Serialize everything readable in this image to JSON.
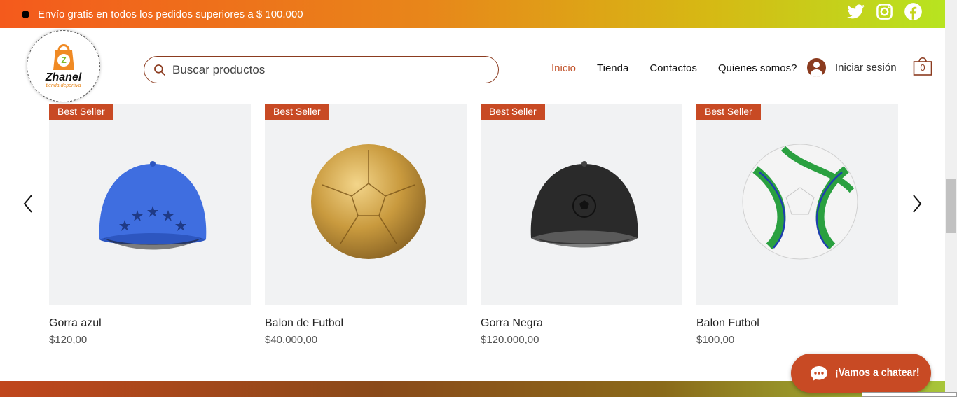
{
  "promo": {
    "text": "Envío gratis en todos los pedidos superiores a $ 100.000"
  },
  "social": [
    "twitter-icon",
    "instagram-icon",
    "facebook-icon"
  ],
  "logo": {
    "name": "Zhanel",
    "tagline": "tienda deportiva"
  },
  "search": {
    "placeholder": "Buscar productos"
  },
  "nav": {
    "items": [
      {
        "label": "Inicio",
        "active": true
      },
      {
        "label": "Tienda",
        "active": false
      },
      {
        "label": "Contactos",
        "active": false
      },
      {
        "label": "Quienes somos?",
        "active": false
      }
    ]
  },
  "login": {
    "label": "Iniciar sesión"
  },
  "cart": {
    "count": "0"
  },
  "products": [
    {
      "badge": "Best Seller",
      "name": "Gorra azul",
      "price": "$120,00",
      "image": "blue-cap"
    },
    {
      "badge": "Best Seller",
      "name": "Balon de Futbol",
      "price": "$40.000,00",
      "image": "gold-soccer-ball"
    },
    {
      "badge": "Best Seller",
      "name": "Gorra Negra",
      "price": "$120.000,00",
      "image": "black-cap"
    },
    {
      "badge": "Best Seller",
      "name": "Balon Futbol",
      "price": "$100,00",
      "image": "green-soccer-ball"
    }
  ],
  "chat": {
    "label": "¡Vamos a chatear!"
  },
  "colors": {
    "accent": "#c84a24",
    "dark_brown": "#8b3b1f",
    "card_bg": "#f1f2f3"
  }
}
